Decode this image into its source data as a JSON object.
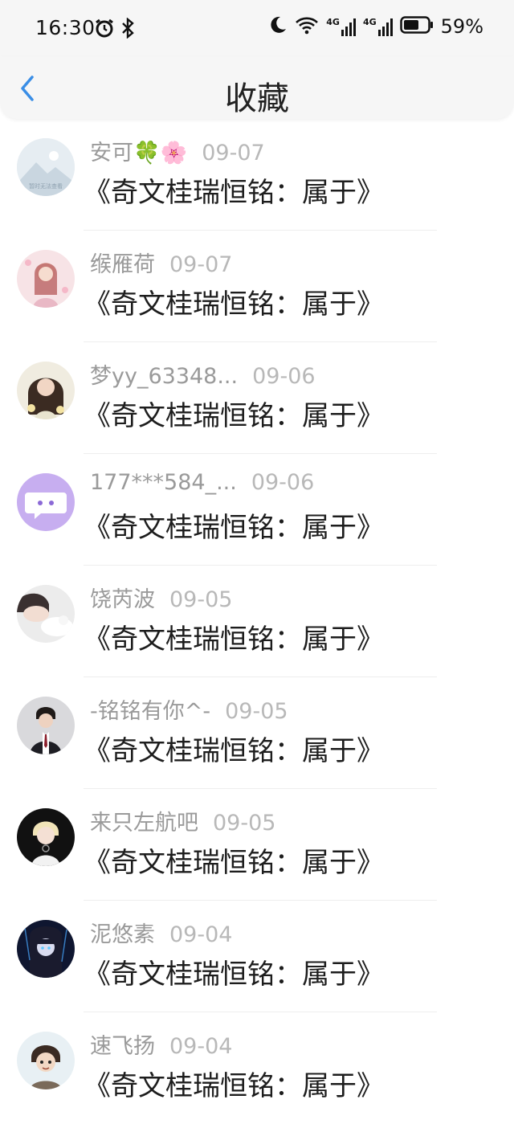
{
  "status_bar": {
    "time": "16:30",
    "battery": "59%",
    "network_a": "4G",
    "network_b": "4G"
  },
  "header": {
    "title": "收藏"
  },
  "items": [
    {
      "name": "安可🍀🌸",
      "date": "09-07",
      "title": "《奇文桂瑞恒铭：属于》",
      "avatar_placeholder_text": "暂时无法查看"
    },
    {
      "name": "缑雁荷",
      "date": "09-07",
      "title": "《奇文桂瑞恒铭：属于》"
    },
    {
      "name": "梦yy_63348...",
      "date": "09-06",
      "title": "《奇文桂瑞恒铭：属于》"
    },
    {
      "name": "177***584_...",
      "date": "09-06",
      "title": "《奇文桂瑞恒铭：属于》"
    },
    {
      "name": "饶芮波",
      "date": "09-05",
      "title": "《奇文桂瑞恒铭：属于》"
    },
    {
      "name": "-铭铭有你^-",
      "date": "09-05",
      "title": "《奇文桂瑞恒铭：属于》"
    },
    {
      "name": "来只左航吧",
      "date": "09-05",
      "title": "《奇文桂瑞恒铭：属于》"
    },
    {
      "name": "泥悠素",
      "date": "09-04",
      "title": "《奇文桂瑞恒铭：属于》"
    },
    {
      "name": "速飞扬",
      "date": "09-04",
      "title": "《奇文桂瑞恒铭：属于》"
    }
  ],
  "colors": {
    "accent": "#3a8ee6",
    "name_gray": "#9a9a9a",
    "date_gray": "#b8b8b8"
  }
}
